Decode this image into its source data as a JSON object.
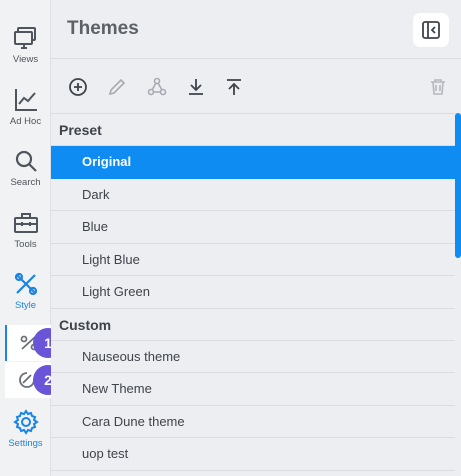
{
  "rail": {
    "items": [
      {
        "label": "Views",
        "icon": "views-icon"
      },
      {
        "label": "Ad Hoc",
        "icon": "adhoc-chart-icon"
      },
      {
        "label": "Search",
        "icon": "search-icon"
      },
      {
        "label": "Tools",
        "icon": "toolbox-icon"
      },
      {
        "label": "Style",
        "icon": "style-icon"
      },
      {
        "label": "Settings",
        "icon": "gear-icon"
      }
    ],
    "badges": [
      "1",
      "2"
    ],
    "active_color": "#1a84e6"
  },
  "panel": {
    "title": "Themes",
    "toolbar": [
      "add-icon",
      "edit-icon",
      "share-icon",
      "download-icon",
      "upload-icon",
      "delete-icon"
    ]
  },
  "themes": {
    "preset_label": "Preset",
    "preset": [
      "Original",
      "Dark",
      "Blue",
      "Light Blue",
      "Light Green"
    ],
    "selected": "Original",
    "custom_label": "Custom",
    "custom": [
      "Nauseous theme",
      "New Theme",
      "Cara Dune theme",
      "uop test"
    ]
  },
  "colors": {
    "accent": "#0e8cf2",
    "badge": "#6a55d8"
  }
}
